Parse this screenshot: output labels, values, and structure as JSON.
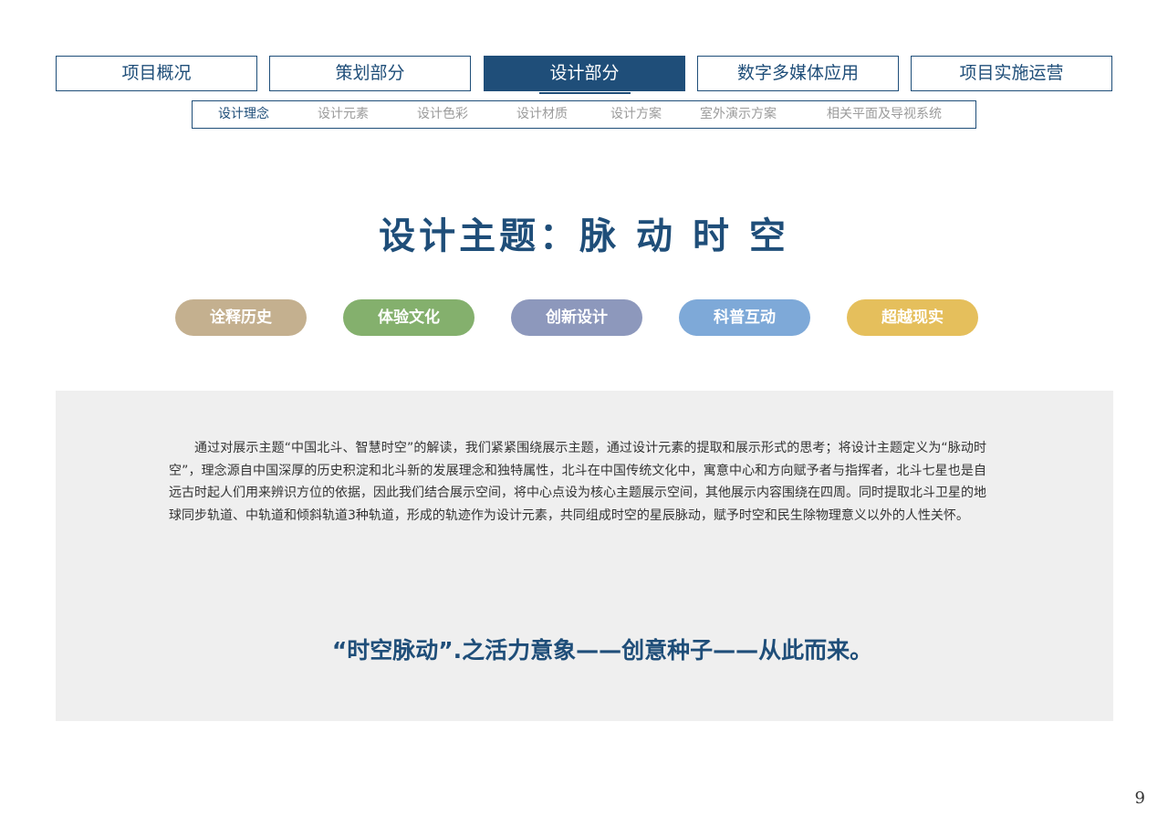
{
  "main_tabs": [
    {
      "label": "项目概况"
    },
    {
      "label": "策划部分"
    },
    {
      "label": "设计部分"
    },
    {
      "label": "数字多媒体应用"
    },
    {
      "label": "项目实施运营"
    }
  ],
  "active_main_tab": "设计部分",
  "sub_tabs": [
    {
      "label": "设计理念"
    },
    {
      "label": "设计元素"
    },
    {
      "label": "设计色彩"
    },
    {
      "label": "设计材质"
    },
    {
      "label": "设计方案"
    },
    {
      "label": "室外演示方案"
    },
    {
      "label": "相关平面及导视系统"
    }
  ],
  "active_sub_tab": "设计理念",
  "title": "设计主题：脉 动 时 空",
  "pills": [
    {
      "label": "诠释历史",
      "color": "#c4b08f"
    },
    {
      "label": "体验文化",
      "color": "#84b06d"
    },
    {
      "label": "创新设计",
      "color": "#8d98bc"
    },
    {
      "label": "科普互动",
      "color": "#7ea9d8"
    },
    {
      "label": "超越现实",
      "color": "#e5bf5c"
    }
  ],
  "body_text": "通过对展示主题“中国北斗、智慧时空”的解读，我们紧紧围绕展示主题，通过设计元素的提取和展示形式的思考；将设计主题定义为“脉动时空”，理念源自中国深厚的历史积淀和北斗新的发展理念和独特属性，北斗在中国传统文化中，寓意中心和方向赋予者与指挥者，北斗七星也是自远古时起人们用来辨识方位的依据，因此我们结合展示空间，将中心点设为核心主题展示空间，其他展示内容围绕在四周。同时提取北斗卫星的地球同步轨道、中轨道和倾斜轨道3种轨道，形成的轨迹作为设计元素，共同组成时空的星辰脉动，赋予时空和民生除物理意义以外的人性关怀。",
  "tagline": "“时空脉动”.之活力意象——创意种子——从此而来。",
  "page_number": "9",
  "colors": {
    "brand": "#1f4e79",
    "panel": "#efefef",
    "inactive_sub_tab": "#9b9b9b"
  }
}
